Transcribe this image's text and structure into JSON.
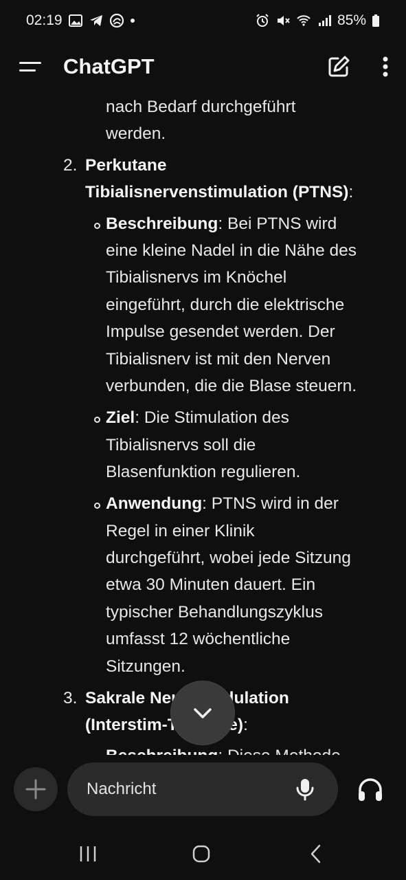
{
  "status_bar": {
    "time": "02:19",
    "battery": "85%",
    "left_icons": [
      "gallery-icon",
      "telegram-icon",
      "app-icon",
      "dot-icon"
    ],
    "right_icons": [
      "alarm-icon",
      "mute-icon",
      "wifi-icon",
      "signal-icon",
      "battery-icon"
    ]
  },
  "header": {
    "title": "ChatGPT",
    "icons": [
      "menu-icon",
      "new-chat-icon",
      "more-icon"
    ]
  },
  "message": {
    "intro_lines": [
      "nach Bedarf durchgeführt",
      "werden."
    ],
    "item2": {
      "number": "2.",
      "heading_line1": "Perkutane",
      "heading_line2": "Tibialisnervenstimulation (PTNS)",
      "heading_suffix": ":",
      "bullets": [
        {
          "label": "Beschreibung",
          "first": ": Bei PTNS wird",
          "lines": [
            "eine kleine Nadel in die Nähe des",
            "Tibialisnervs im Knöchel",
            "eingeführt, durch die elektrische",
            "Impulse gesendet werden. Der",
            "Tibialisnerv ist mit den Nerven",
            "verbunden, die die Blase steuern."
          ]
        },
        {
          "label": "Ziel",
          "first": ": Die Stimulation des",
          "lines": [
            "Tibialisnervs soll die",
            "Blasenfunktion regulieren."
          ]
        },
        {
          "label": "Anwendung",
          "first": ": PTNS wird in der",
          "lines": [
            "Regel in einer Klinik",
            "durchgeführt, wobei jede Sitzung",
            "etwa 30 Minuten dauert. Ein",
            "typischer Behandlungszyklus",
            "umfasst 12 wöchentliche",
            "Sitzungen."
          ]
        }
      ]
    },
    "item3": {
      "number": "3.",
      "heading_line1": "Sakrale Neuromodulation",
      "heading_line2": "(Interstim-Therapie)",
      "heading_suffix": ":",
      "partial_label": "Beschreibung",
      "partial_text": ": Diese Methode"
    }
  },
  "scroll_button": {
    "icon": "chevron-down-icon"
  },
  "composer": {
    "placeholder": "Nachricht",
    "icons": [
      "plus-icon",
      "microphone-icon",
      "headphones-icon"
    ]
  },
  "nav_bar": {
    "icons": [
      "recents-icon",
      "home-icon",
      "back-icon"
    ]
  },
  "colors": {
    "background": "#0f0f0f",
    "text": "#ececec",
    "pill": "#2b2b2b"
  }
}
